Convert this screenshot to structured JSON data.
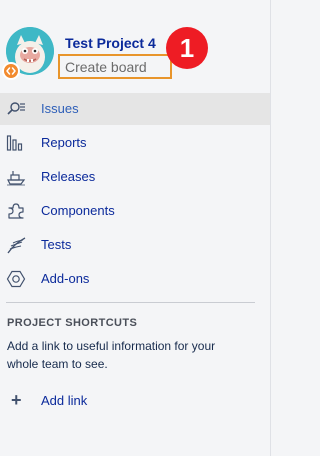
{
  "header": {
    "project_name": "Test Project 4",
    "create_board_label": "Create board",
    "step_number": "1"
  },
  "nav": {
    "items": [
      {
        "label": "Issues",
        "icon": "issues-icon",
        "active": true
      },
      {
        "label": "Reports",
        "icon": "reports-icon"
      },
      {
        "label": "Releases",
        "icon": "releases-icon"
      },
      {
        "label": "Components",
        "icon": "components-icon"
      },
      {
        "label": "Tests",
        "icon": "tests-icon"
      },
      {
        "label": "Add-ons",
        "icon": "add-ons-icon"
      }
    ]
  },
  "shortcuts": {
    "heading": "PROJECT SHORTCUTS",
    "description": "Add a link to useful information for your whole team to see.",
    "add_link_label": "Add link",
    "add_link_icon": "plus-icon"
  },
  "colors": {
    "link": "#0b2a9b",
    "active_bg": "#e5e5e5",
    "highlight_border": "#e8952b",
    "step_badge": "#ee1c24",
    "avatar_bg": "#3fb8c6"
  }
}
